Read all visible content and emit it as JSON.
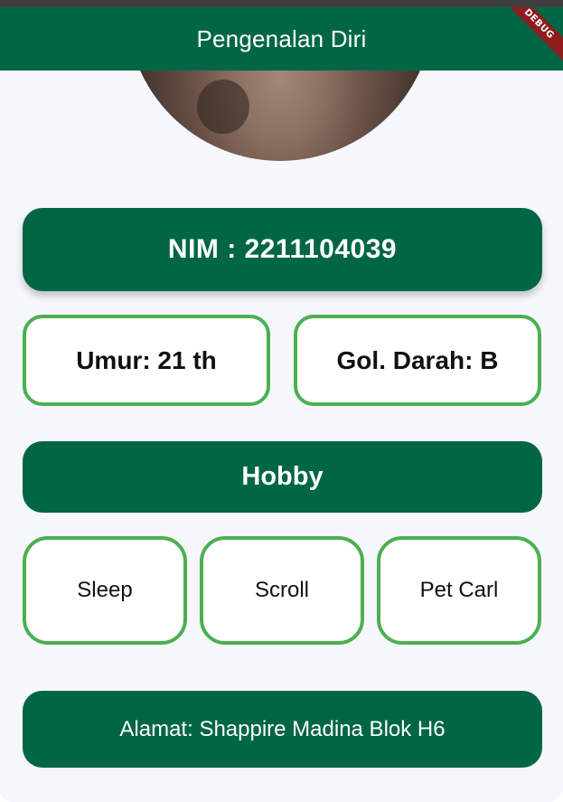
{
  "app_bar": {
    "title": "Pengenalan Diri",
    "debug_label": "DEBUG",
    "color": "#006644"
  },
  "profile": {
    "nim": "NIM : 2211104039",
    "age": "Umur: 21 th",
    "blood_type": "Gol. Darah: B"
  },
  "hobby": {
    "title": "Hobby",
    "items": [
      "Sleep",
      "Scroll",
      "Pet Carl"
    ]
  },
  "address": "Alamat: Shappire Madina Blok H6",
  "colors": {
    "primary": "#006644",
    "outline": "#4caf50",
    "background": "#f6f7fd"
  }
}
